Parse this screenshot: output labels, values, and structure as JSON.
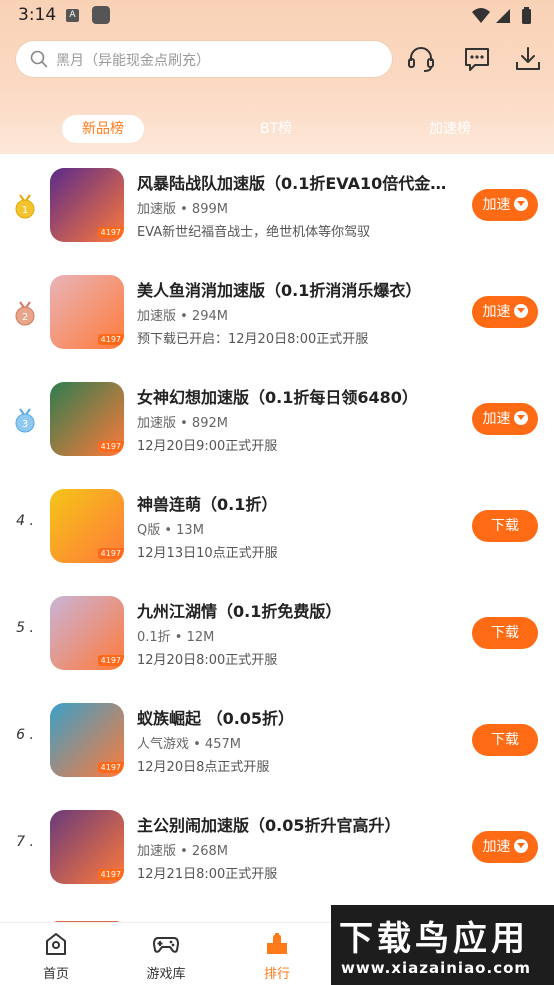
{
  "status_bar": {
    "time": "3:14",
    "notif_letter": "A"
  },
  "search": {
    "placeholder": "黑月（异能现金点刷充）"
  },
  "header_icons": [
    "headset-icon",
    "message-icon",
    "download-icon"
  ],
  "tabs": [
    {
      "label": "新品榜",
      "active": true
    },
    {
      "label": "BT榜",
      "active": false
    },
    {
      "label": "加速榜",
      "active": false
    }
  ],
  "games": [
    {
      "rank": "1",
      "medal": "gold",
      "title": "风暴陆战队加速版（0.1折EVA10倍代金…",
      "meta": "加速版 • 899M",
      "desc": "EVA新世纪福音战士，绝世机体等你驾驭",
      "button": "加速",
      "has_caret": true,
      "tag": "4197",
      "icon_color": "#5a2a8a"
    },
    {
      "rank": "2",
      "medal": "bronze",
      "title": "美人鱼消消加速版（0.1折消消乐爆衣）",
      "meta": "加速版 • 294M",
      "desc": "预下载已开启：12月20日8:00正式开服",
      "button": "加速",
      "has_caret": true,
      "tag": "4197",
      "icon_color": "#e8b4b8"
    },
    {
      "rank": "3",
      "medal": "blue",
      "title": "女神幻想加速版（0.1折每日领6480）",
      "meta": "加速版 • 892M",
      "desc": "12月20日9:00正式开服",
      "button": "加速",
      "has_caret": true,
      "tag": "4197",
      "icon_color": "#2e7d4f"
    },
    {
      "rank": "4 .",
      "medal": "",
      "title": "神兽连萌（0.1折）",
      "meta": "Q版 • 13M",
      "desc": "12月13日10点正式开服",
      "button": "下载",
      "has_caret": false,
      "tag": "4197",
      "icon_color": "#f5c518"
    },
    {
      "rank": "5 .",
      "medal": "",
      "title": "九州江湖情（0.1折免费版）",
      "meta": "0.1折 • 12M",
      "desc": "12月20日8:00正式开服",
      "button": "下载",
      "has_caret": false,
      "tag": "4197",
      "icon_color": "#c9b4d8"
    },
    {
      "rank": "6 .",
      "medal": "",
      "title": "蚁族崛起 （0.05折）",
      "meta": "人气游戏 • 457M",
      "desc": "12月20日8点正式开服",
      "button": "下载",
      "has_caret": false,
      "tag": "4197",
      "icon_color": "#3aa0c8"
    },
    {
      "rank": "7 .",
      "medal": "",
      "title": "主公别闹加速版（0.05折升官高升）",
      "meta": "加速版 • 268M",
      "desc": "12月21日8:00正式开服",
      "button": "加速",
      "has_caret": true,
      "tag": "4197",
      "icon_color": "#6a3a7a"
    }
  ],
  "bottom_nav": [
    {
      "label": "首页",
      "icon": "home-icon",
      "active": false
    },
    {
      "label": "游戏库",
      "icon": "gamepad-icon",
      "active": false
    },
    {
      "label": "排行",
      "icon": "ranking-icon",
      "active": true
    }
  ],
  "watermark": {
    "line1": "下载鸟应用",
    "line2": "www.xiazainiao.com"
  },
  "colors": {
    "accent": "#ff6a14",
    "header_top": "#f9d2b6"
  }
}
